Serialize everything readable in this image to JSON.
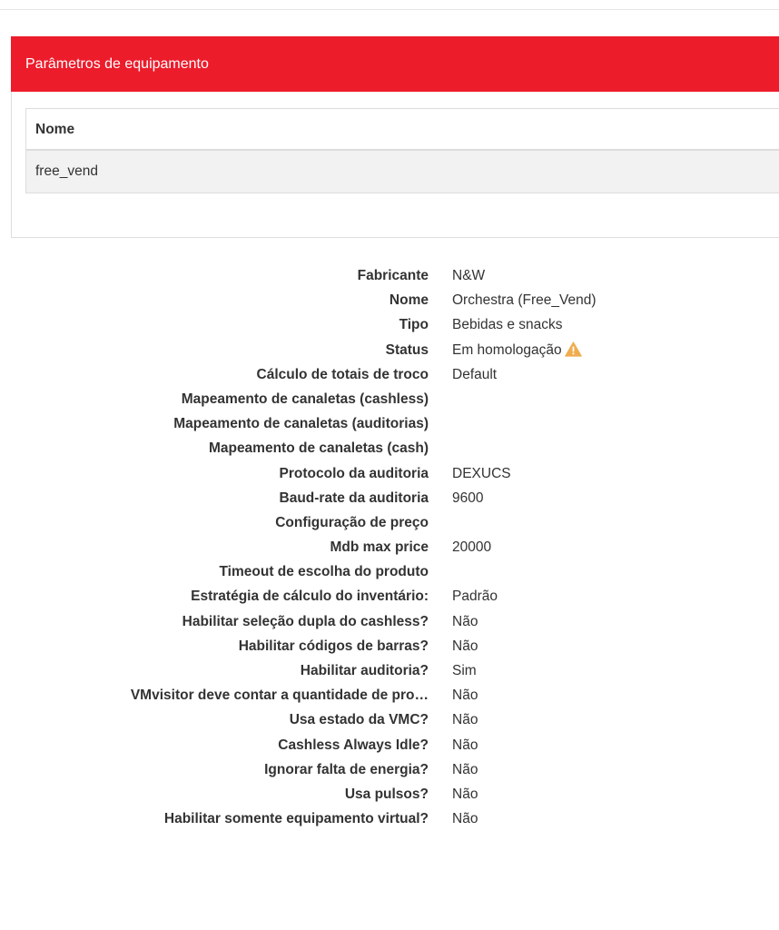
{
  "panel": {
    "title": "Parâmetros de equipamento",
    "table": {
      "header": "Nome",
      "rows": [
        "free_vend"
      ]
    }
  },
  "details": [
    {
      "label": "Fabricante",
      "value": "N&W"
    },
    {
      "label": "Nome",
      "value": "Orchestra (Free_Vend)"
    },
    {
      "label": "Tipo",
      "value": "Bebidas e snacks"
    },
    {
      "label": "Status",
      "value": "Em homologação",
      "icon": "warning-icon"
    },
    {
      "label": "Cálculo de totais de troco",
      "value": "Default"
    },
    {
      "label": "Mapeamento de canaletas (cashless)",
      "value": ""
    },
    {
      "label": "Mapeamento de canaletas (auditorias)",
      "value": ""
    },
    {
      "label": "Mapeamento de canaletas (cash)",
      "value": ""
    },
    {
      "label": "Protocolo da auditoria",
      "value": "DEXUCS"
    },
    {
      "label": "Baud-rate da auditoria",
      "value": "9600"
    },
    {
      "label": "Configuração de preço",
      "value": ""
    },
    {
      "label": "Mdb max price",
      "value": "20000"
    },
    {
      "label": "Timeout de escolha do produto",
      "value": ""
    },
    {
      "label": "Estratégia de cálculo do inventário:",
      "value": "Padrão"
    },
    {
      "label": "Habilitar seleção dupla do cashless?",
      "value": "Não"
    },
    {
      "label": "Habilitar códigos de barras?",
      "value": "Não"
    },
    {
      "label": "Habilitar auditoria?",
      "value": "Sim"
    },
    {
      "label": "VMvisitor deve contar a quantidade de pro…",
      "value": "Não"
    },
    {
      "label": "Usa estado da VMC?",
      "value": "Não"
    },
    {
      "label": "Cashless Always Idle?",
      "value": "Não"
    },
    {
      "label": "Ignorar falta de energia?",
      "value": "Não"
    },
    {
      "label": "Usa pulsos?",
      "value": "Não"
    },
    {
      "label": "Habilitar somente equipamento virtual?",
      "value": "Não"
    }
  ],
  "colors": {
    "heading_bg": "#ec1c2b",
    "warning": "#f0ad4e"
  }
}
